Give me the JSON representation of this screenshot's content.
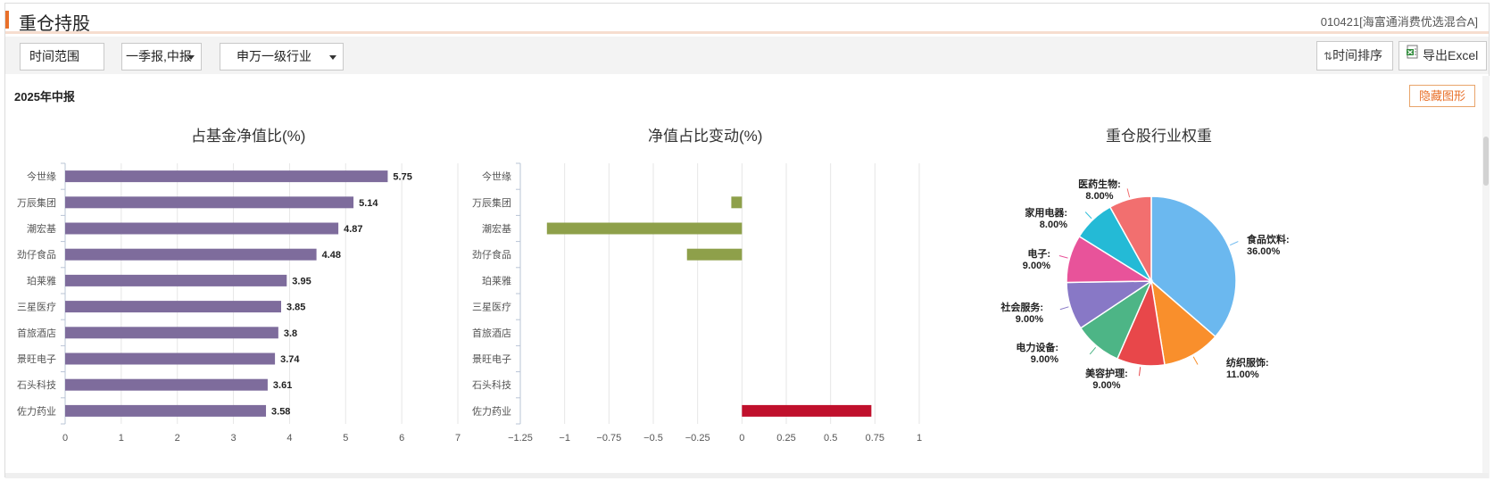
{
  "header": {
    "title": "重仓持股",
    "fund_name": "010421[海富通消费优选混合A]"
  },
  "toolbar": {
    "time_range_label": "时间范围",
    "period_value": "一季报,中报",
    "industry_value": "申万一级行业",
    "sort_label": "时间排序",
    "export_label": "导出Excel"
  },
  "report_title": "2025年中报",
  "hide_chart_label": "隐藏图形",
  "chart_data": [
    {
      "type": "bar",
      "orientation": "horizontal",
      "title": "占基金净值比(%)",
      "categories": [
        "今世缘",
        "万辰集团",
        "潮宏基",
        "劲仔食品",
        "珀莱雅",
        "三星医疗",
        "首旅酒店",
        "景旺电子",
        "石头科技",
        "佐力药业"
      ],
      "values": [
        5.75,
        5.14,
        4.87,
        4.48,
        3.95,
        3.85,
        3.8,
        3.74,
        3.61,
        3.58
      ],
      "value_labels": [
        "5.75",
        "5.14",
        "4.87",
        "4.48",
        "3.95",
        "3.85",
        "3.8",
        "3.74",
        "3.61",
        "3.58"
      ],
      "xlim": [
        0,
        7
      ],
      "xticks": [
        "0",
        "1",
        "2",
        "3",
        "4",
        "5",
        "6",
        "7"
      ],
      "bar_color": "#7e6c9c",
      "grid": true
    },
    {
      "type": "bar",
      "orientation": "horizontal",
      "title": "净值占比变动(%)",
      "categories": [
        "今世缘",
        "万辰集团",
        "潮宏基",
        "劲仔食品",
        "珀莱雅",
        "三星医疗",
        "首旅酒店",
        "景旺电子",
        "石头科技",
        "佐力药业"
      ],
      "values": [
        0,
        -0.06,
        -1.1,
        -0.31,
        0,
        0,
        0,
        0,
        0,
        0.73
      ],
      "xlim": [
        -1.25,
        1
      ],
      "xticks": [
        "−1.25",
        "−1",
        "−0.75",
        "−0.5",
        "−0.25",
        "0",
        "0.25",
        "0.5",
        "0.75",
        "1"
      ],
      "negative_color": "#8ea04a",
      "positive_color": "#c0102c",
      "grid": true
    },
    {
      "type": "pie",
      "title": "重仓股行业权重",
      "slices": [
        {
          "label": "食品饮料",
          "value": 36.0,
          "value_text": "36.00%",
          "color": "#6bb8ef"
        },
        {
          "label": "纺织服饰",
          "value": 11.0,
          "value_text": "11.00%",
          "color": "#f98f2c"
        },
        {
          "label": "美容护理",
          "value": 9.0,
          "value_text": "9.00%",
          "color": "#e8474a"
        },
        {
          "label": "电力设备",
          "value": 9.0,
          "value_text": "9.00%",
          "color": "#4db586"
        },
        {
          "label": "社会服务",
          "value": 9.0,
          "value_text": "9.00%",
          "color": "#8878c6"
        },
        {
          "label": "电子",
          "value": 9.0,
          "value_text": "9.00%",
          "color": "#e8539a"
        },
        {
          "label": "家用电器",
          "value": 8.0,
          "value_text": "8.00%",
          "color": "#24bad6"
        },
        {
          "label": "医药生物",
          "value": 8.0,
          "value_text": "8.00%",
          "color": "#f26f6f"
        }
      ]
    }
  ]
}
